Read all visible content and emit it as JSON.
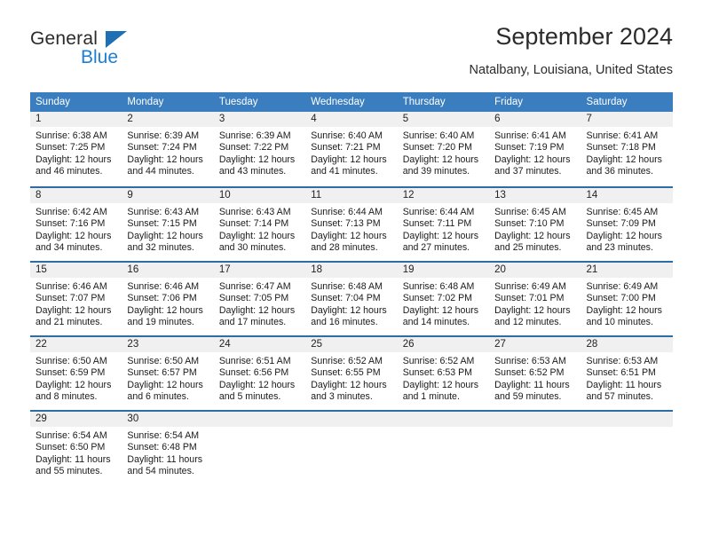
{
  "brand": {
    "name_top": "General",
    "name_bottom": "Blue",
    "accent_color": "#1b7fd4",
    "triangle_color": "#1f6fb5"
  },
  "header": {
    "title": "September 2024",
    "subtitle": "Natalbany, Louisiana, United States"
  },
  "calendar": {
    "header_background": "#3a7ebf",
    "header_text_color": "#ffffff",
    "row_separator_color": "#2e6da4",
    "daynum_band_color": "#f0f0f0",
    "weekdays": [
      "Sunday",
      "Monday",
      "Tuesday",
      "Wednesday",
      "Thursday",
      "Friday",
      "Saturday"
    ],
    "labels": {
      "sunrise": "Sunrise:",
      "sunset": "Sunset:",
      "daylight": "Daylight:"
    },
    "weeks": [
      [
        {
          "day": "1",
          "sunrise": "Sunrise: 6:38 AM",
          "sunset": "Sunset: 7:25 PM",
          "daylight": "Daylight: 12 hours and 46 minutes."
        },
        {
          "day": "2",
          "sunrise": "Sunrise: 6:39 AM",
          "sunset": "Sunset: 7:24 PM",
          "daylight": "Daylight: 12 hours and 44 minutes."
        },
        {
          "day": "3",
          "sunrise": "Sunrise: 6:39 AM",
          "sunset": "Sunset: 7:22 PM",
          "daylight": "Daylight: 12 hours and 43 minutes."
        },
        {
          "day": "4",
          "sunrise": "Sunrise: 6:40 AM",
          "sunset": "Sunset: 7:21 PM",
          "daylight": "Daylight: 12 hours and 41 minutes."
        },
        {
          "day": "5",
          "sunrise": "Sunrise: 6:40 AM",
          "sunset": "Sunset: 7:20 PM",
          "daylight": "Daylight: 12 hours and 39 minutes."
        },
        {
          "day": "6",
          "sunrise": "Sunrise: 6:41 AM",
          "sunset": "Sunset: 7:19 PM",
          "daylight": "Daylight: 12 hours and 37 minutes."
        },
        {
          "day": "7",
          "sunrise": "Sunrise: 6:41 AM",
          "sunset": "Sunset: 7:18 PM",
          "daylight": "Daylight: 12 hours and 36 minutes."
        }
      ],
      [
        {
          "day": "8",
          "sunrise": "Sunrise: 6:42 AM",
          "sunset": "Sunset: 7:16 PM",
          "daylight": "Daylight: 12 hours and 34 minutes."
        },
        {
          "day": "9",
          "sunrise": "Sunrise: 6:43 AM",
          "sunset": "Sunset: 7:15 PM",
          "daylight": "Daylight: 12 hours and 32 minutes."
        },
        {
          "day": "10",
          "sunrise": "Sunrise: 6:43 AM",
          "sunset": "Sunset: 7:14 PM",
          "daylight": "Daylight: 12 hours and 30 minutes."
        },
        {
          "day": "11",
          "sunrise": "Sunrise: 6:44 AM",
          "sunset": "Sunset: 7:13 PM",
          "daylight": "Daylight: 12 hours and 28 minutes."
        },
        {
          "day": "12",
          "sunrise": "Sunrise: 6:44 AM",
          "sunset": "Sunset: 7:11 PM",
          "daylight": "Daylight: 12 hours and 27 minutes."
        },
        {
          "day": "13",
          "sunrise": "Sunrise: 6:45 AM",
          "sunset": "Sunset: 7:10 PM",
          "daylight": "Daylight: 12 hours and 25 minutes."
        },
        {
          "day": "14",
          "sunrise": "Sunrise: 6:45 AM",
          "sunset": "Sunset: 7:09 PM",
          "daylight": "Daylight: 12 hours and 23 minutes."
        }
      ],
      [
        {
          "day": "15",
          "sunrise": "Sunrise: 6:46 AM",
          "sunset": "Sunset: 7:07 PM",
          "daylight": "Daylight: 12 hours and 21 minutes."
        },
        {
          "day": "16",
          "sunrise": "Sunrise: 6:46 AM",
          "sunset": "Sunset: 7:06 PM",
          "daylight": "Daylight: 12 hours and 19 minutes."
        },
        {
          "day": "17",
          "sunrise": "Sunrise: 6:47 AM",
          "sunset": "Sunset: 7:05 PM",
          "daylight": "Daylight: 12 hours and 17 minutes."
        },
        {
          "day": "18",
          "sunrise": "Sunrise: 6:48 AM",
          "sunset": "Sunset: 7:04 PM",
          "daylight": "Daylight: 12 hours and 16 minutes."
        },
        {
          "day": "19",
          "sunrise": "Sunrise: 6:48 AM",
          "sunset": "Sunset: 7:02 PM",
          "daylight": "Daylight: 12 hours and 14 minutes."
        },
        {
          "day": "20",
          "sunrise": "Sunrise: 6:49 AM",
          "sunset": "Sunset: 7:01 PM",
          "daylight": "Daylight: 12 hours and 12 minutes."
        },
        {
          "day": "21",
          "sunrise": "Sunrise: 6:49 AM",
          "sunset": "Sunset: 7:00 PM",
          "daylight": "Daylight: 12 hours and 10 minutes."
        }
      ],
      [
        {
          "day": "22",
          "sunrise": "Sunrise: 6:50 AM",
          "sunset": "Sunset: 6:59 PM",
          "daylight": "Daylight: 12 hours and 8 minutes."
        },
        {
          "day": "23",
          "sunrise": "Sunrise: 6:50 AM",
          "sunset": "Sunset: 6:57 PM",
          "daylight": "Daylight: 12 hours and 6 minutes."
        },
        {
          "day": "24",
          "sunrise": "Sunrise: 6:51 AM",
          "sunset": "Sunset: 6:56 PM",
          "daylight": "Daylight: 12 hours and 5 minutes."
        },
        {
          "day": "25",
          "sunrise": "Sunrise: 6:52 AM",
          "sunset": "Sunset: 6:55 PM",
          "daylight": "Daylight: 12 hours and 3 minutes."
        },
        {
          "day": "26",
          "sunrise": "Sunrise: 6:52 AM",
          "sunset": "Sunset: 6:53 PM",
          "daylight": "Daylight: 12 hours and 1 minute."
        },
        {
          "day": "27",
          "sunrise": "Sunrise: 6:53 AM",
          "sunset": "Sunset: 6:52 PM",
          "daylight": "Daylight: 11 hours and 59 minutes."
        },
        {
          "day": "28",
          "sunrise": "Sunrise: 6:53 AM",
          "sunset": "Sunset: 6:51 PM",
          "daylight": "Daylight: 11 hours and 57 minutes."
        }
      ],
      [
        {
          "day": "29",
          "sunrise": "Sunrise: 6:54 AM",
          "sunset": "Sunset: 6:50 PM",
          "daylight": "Daylight: 11 hours and 55 minutes."
        },
        {
          "day": "30",
          "sunrise": "Sunrise: 6:54 AM",
          "sunset": "Sunset: 6:48 PM",
          "daylight": "Daylight: 11 hours and 54 minutes."
        },
        {
          "day": "",
          "sunrise": "",
          "sunset": "",
          "daylight": ""
        },
        {
          "day": "",
          "sunrise": "",
          "sunset": "",
          "daylight": ""
        },
        {
          "day": "",
          "sunrise": "",
          "sunset": "",
          "daylight": ""
        },
        {
          "day": "",
          "sunrise": "",
          "sunset": "",
          "daylight": ""
        },
        {
          "day": "",
          "sunrise": "",
          "sunset": "",
          "daylight": ""
        }
      ]
    ]
  }
}
